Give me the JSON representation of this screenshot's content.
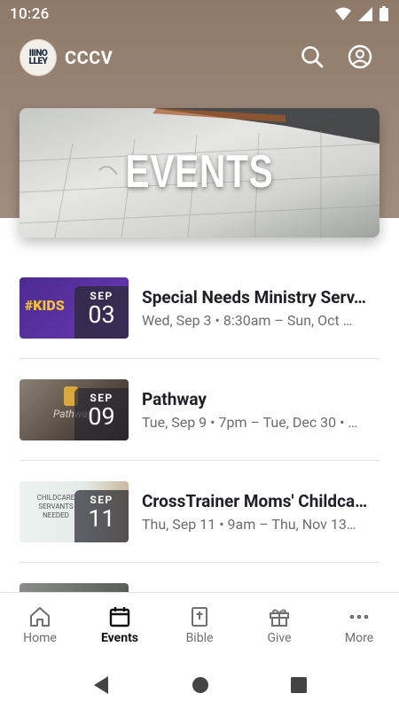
{
  "status": {
    "time": "10:26"
  },
  "app": {
    "title": "CCCV",
    "logo_text": "IIINO\nLLEY"
  },
  "banner": {
    "title": "EVENTS"
  },
  "events": [
    {
      "month": "SEP",
      "day": "03",
      "title": "Special Needs Ministry Serv…",
      "subtitle": "Wed, Sep 3 • 8:30am – Sun, Oct …",
      "thumb_text": "#KIDS"
    },
    {
      "month": "SEP",
      "day": "09",
      "title": "Pathway",
      "subtitle": "Tue, Sep 9 • 7pm – Tue, Dec 30 • …",
      "thumb_text": "Pathway"
    },
    {
      "month": "SEP",
      "day": "11",
      "title": "CrossTrainer Moms' Childca…",
      "subtitle": "Thu, Sep 11 • 9am – Thu, Nov 13…",
      "thumb_text": "CHILDCARE SERVANTS NEEDED"
    }
  ],
  "nav": {
    "home": "Home",
    "events": "Events",
    "bible": "Bible",
    "give": "Give",
    "more": "More"
  },
  "colors": {
    "header_brown": "#9a8676",
    "active_nav": "#111111"
  }
}
